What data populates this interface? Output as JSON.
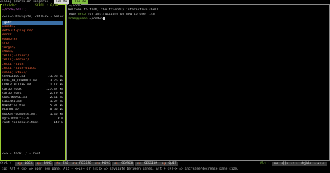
{
  "topbar": {
    "session": "Zellij (circular-kangaroo)",
    "tab1": "Tab #1",
    "tab2": "Tab #2"
  },
  "left_pane": {
    "title": "strider",
    "scroll": "SCROLL: 0/29",
    "path": "~/code/zellij",
    "hint_nav": "<←↓↑→> Navigate, <ENTER> - Select",
    "dirs": [
      ".git/",
      "assets/",
      "default-plugins/",
      "docs/",
      "example/",
      "src/",
      "target/",
      "xtask/",
      "zellij-client/",
      "zellij-server/",
      "zellij-tile/",
      "zellij-tile-utils/",
      "zellij-utils/"
    ],
    "files": [
      {
        "name": "CHANGELOG.md",
        "size": "73.98 kB"
      },
      {
        "name": "CODE_OF_CONDUCT.md",
        "size": "3.26 kB"
      },
      {
        "name": "CONTRIBUTING.md",
        "size": "11.17 kB"
      },
      {
        "name": "Cargo.lock",
        "size": "127.37 kB"
      },
      {
        "name": "Cargo.toml",
        "size": "2.79 kB"
      },
      {
        "name": "GOVERNANCE.md",
        "size": "2.61 kB"
      },
      {
        "name": "LICENSE.md",
        "size": "1.07 kB"
      },
      {
        "name": "Makefile.toml",
        "size": "5.81 kB"
      },
      {
        "name": "README.md",
        "size": "8.08 kB"
      },
      {
        "name": "docker-compose.yml",
        "size": "1.45 kB"
      },
      {
        "name": "my-chosen-file",
        "size": "0 B"
      },
      {
        "name": "rust-toolchain.toml",
        "size": "149 B"
      }
    ],
    "hint_back": "<←> - back, / - root"
  },
  "right_pane": {
    "title": "~/code",
    "welcome": "Welcome to fish, the friendly interactive shell",
    "help_prefix": "Type ",
    "help_cmd": "help",
    "help_suffix": " for instructions on how to use fish",
    "prompt_user": "aram@green",
    "prompt_path": " ~/code>"
  },
  "modebar": {
    "ctrl": "Ctrl +",
    "keys": [
      {
        "key": "g",
        "label": "LOCK"
      },
      {
        "key": "p",
        "label": "PANE"
      },
      {
        "key": "t",
        "label": "TAB"
      },
      {
        "key": "n",
        "label": "RESIZE"
      },
      {
        "key": "h",
        "label": "MOVE"
      },
      {
        "key": "s",
        "label": "SEARCH"
      },
      {
        "key": "o",
        "label": "SESSION"
      },
      {
        "key": "q",
        "label": "QUIT"
      }
    ]
  },
  "tipbar": {
    "tip": "Tip: Alt + <n> => open new pane. Alt + <←↓↑→ or hjkl> => navigate between panes. Alt + <+|-> => increase/decrease pane size.",
    "alt": "Alt +",
    "alt_keys": "<n> <[]> <+-> <hjkl> <←↓↑→>"
  },
  "colors": {
    "accent_green": "#7fbf3f",
    "dir_orange": "#ff6a3c",
    "selection_blue": "#3a6ea5"
  }
}
